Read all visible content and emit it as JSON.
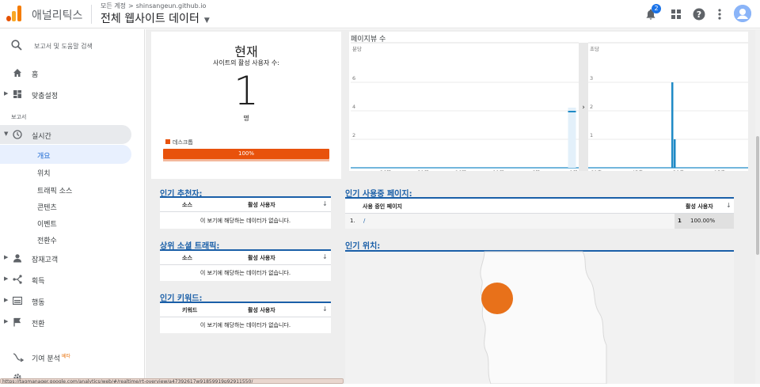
{
  "header": {
    "app_name": "애널리틱스",
    "breadcrumb": [
      "모든 계정",
      "shinsangeun.github.io"
    ],
    "property_title": "전체 웹사이트 데이터",
    "notification_count": "2",
    "icons": [
      "bell-icon",
      "apps-icon",
      "help-icon",
      "more-vert-icon",
      "avatar"
    ]
  },
  "sidebar": {
    "search_placeholder": "보고서 및 도움말 검색",
    "home": "홈",
    "customization": "맞춤설정",
    "reports_section": "보고서",
    "realtime": "실시간",
    "realtime_items": [
      "개요",
      "위치",
      "트래픽 소스",
      "콘텐츠",
      "이벤트",
      "전환수"
    ],
    "audience": "잠재고객",
    "acquisition": "획득",
    "behavior": "행동",
    "conversions": "전환",
    "attribution": "기여 분석",
    "attribution_badge": "베타"
  },
  "now_panel": {
    "title": "현재",
    "subtitle": "사이트의 활성 사용자 수:",
    "active_users": "1",
    "unit": "명",
    "device_label": "데스크톱",
    "device_percent": "100%",
    "device_share": 1.0
  },
  "chart_data": [
    {
      "type": "bar",
      "title": "페이지뷰 수",
      "subtitle": "분당",
      "x_tick_labels": [
        "-26분",
        "-21분",
        "-16분",
        "-11분",
        "-6분",
        "-1분"
      ],
      "y_tick_labels": [
        "2",
        "4",
        "6"
      ],
      "ylim": [
        0,
        8
      ],
      "categories": [
        "-1분"
      ],
      "values": [
        4
      ],
      "color": "#1f8ac6"
    },
    {
      "type": "bar",
      "subtitle": "초당",
      "x_tick_labels": [
        "-60초",
        "-45초",
        "-30초",
        "-15초"
      ],
      "y_tick_labels": [
        "1",
        "2",
        "3"
      ],
      "ylim": [
        0,
        4
      ],
      "categories": [
        "-30초",
        "-29초"
      ],
      "values": [
        3.0,
        1.0
      ],
      "color": "#1f8ac6"
    }
  ],
  "referrers": {
    "title": "인기 추천자:",
    "columns": [
      "소스",
      "활성 사용자"
    ],
    "empty": "이 보기에 해당하는 데이터가 없습니다."
  },
  "social": {
    "title": "상위 소셜 트래픽:",
    "columns": [
      "소스",
      "활성 사용자"
    ],
    "empty": "이 보기에 해당하는 데이터가 없습니다."
  },
  "keywords": {
    "title": "인기 키워드:",
    "columns": [
      "키워드",
      "활성 사용자"
    ],
    "empty": "이 보기에 해당하는 데이터가 없습니다."
  },
  "active_pages": {
    "title": "인기 사용중 페이지:",
    "columns": [
      "사용 중인 페이지",
      "활성 사용자"
    ],
    "rows": [
      {
        "index": "1.",
        "page": "/",
        "users": "1",
        "percent": "100.00%"
      }
    ]
  },
  "locations": {
    "title": "인기 위치:",
    "bubble_color": "#e8711a"
  },
  "status_url": "https://tagmanager.google.com/analytics/web/#/realtime/rt-overview/a47392617w91859919p92911550/"
}
